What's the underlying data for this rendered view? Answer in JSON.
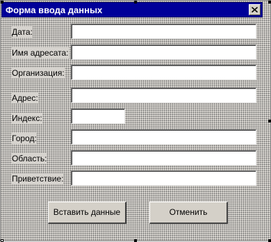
{
  "window": {
    "title": "Форма ввода данных"
  },
  "form": {
    "fields": [
      {
        "label": "Дата:",
        "value": ""
      },
      {
        "label": "Имя адресата:",
        "value": ""
      },
      {
        "label": "Организация:",
        "value": ""
      },
      {
        "label": "Адрес:",
        "value": ""
      },
      {
        "label": "Индекс:",
        "value": ""
      },
      {
        "label": "Город:",
        "value": ""
      },
      {
        "label": "Область:",
        "value": ""
      },
      {
        "label": "Приветствие:",
        "value": ""
      }
    ]
  },
  "buttons": {
    "insert_label": "Вставить данные",
    "cancel_label": "Отменить"
  },
  "icons": {
    "close": "close-icon"
  },
  "colors": {
    "titlebar": "#000099",
    "window_background": "#d6d3ce"
  }
}
